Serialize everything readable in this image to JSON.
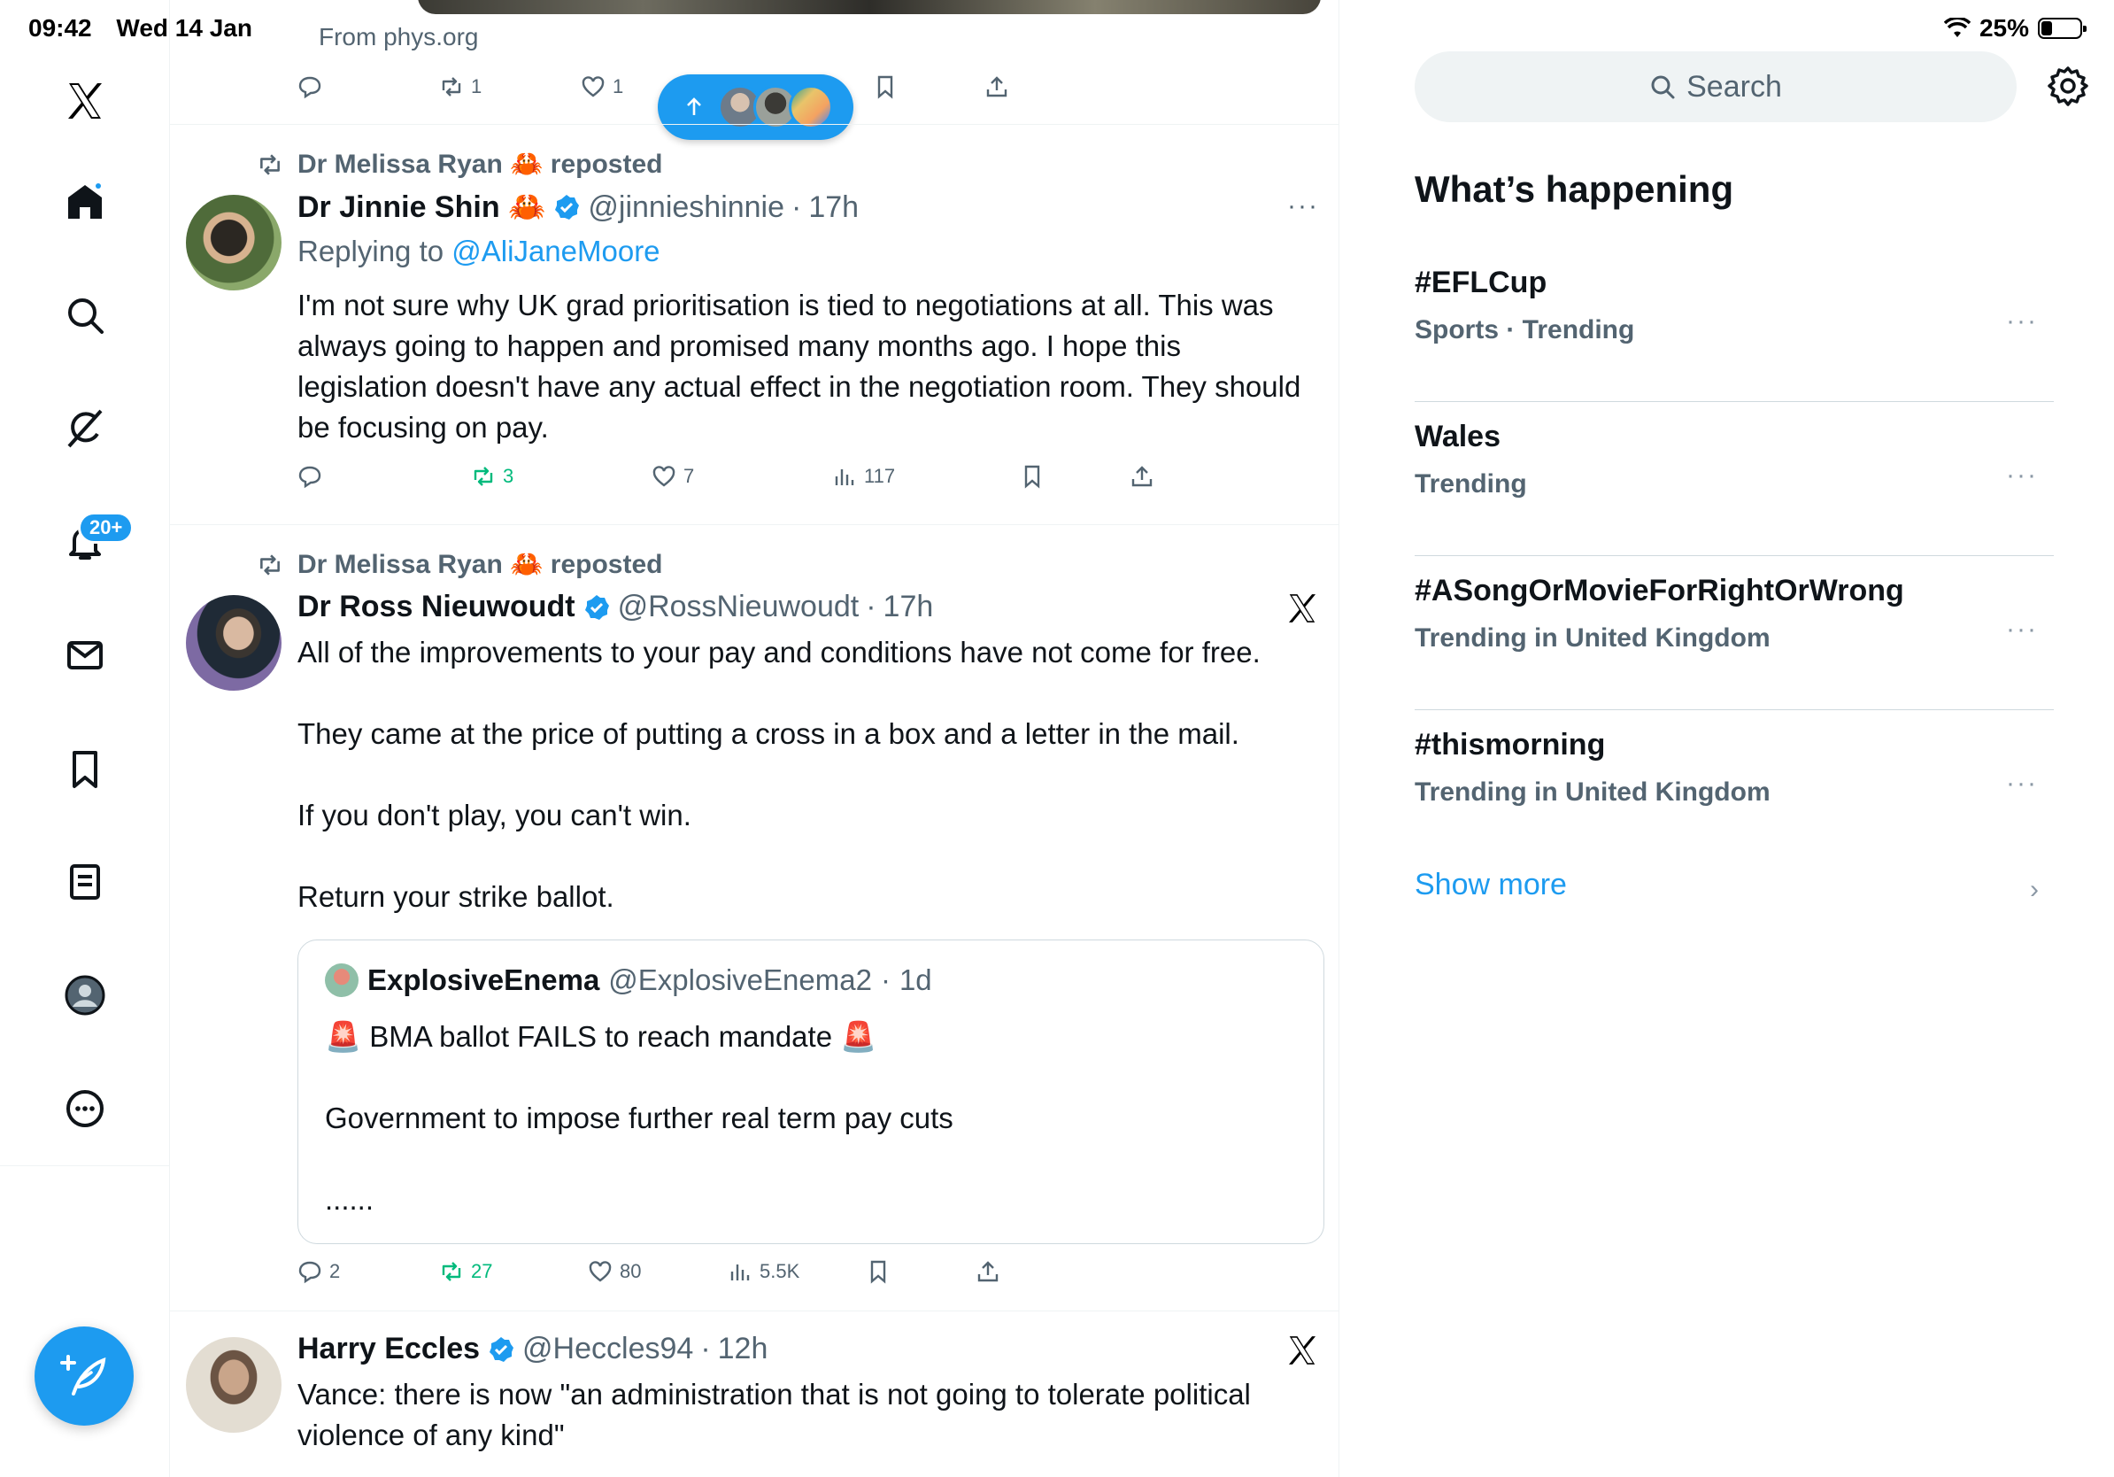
{
  "status_bar": {
    "time": "09:42",
    "date": "Wed 14 Jan",
    "battery": "25%"
  },
  "sidebar": {
    "items": [
      {
        "name": "x-logo"
      },
      {
        "name": "home"
      },
      {
        "name": "explore"
      },
      {
        "name": "grok"
      },
      {
        "name": "notifications"
      },
      {
        "name": "messages"
      },
      {
        "name": "bookmarks"
      },
      {
        "name": "lists"
      },
      {
        "name": "profile"
      },
      {
        "name": "more"
      }
    ],
    "notification_badge": "20+"
  },
  "feed": {
    "previous_post": {
      "source": "From phys.org",
      "replies": "",
      "reposts": "1",
      "likes": "1"
    },
    "posts": [
      {
        "repost_by": "Dr Melissa Ryan 🦀 reposted",
        "author": "Dr Jinnie Shin 🦀",
        "handle": "@jinnieshinnie",
        "time": "17h",
        "replying_prefix": "Replying to ",
        "replying_to": "@AliJaneMoore",
        "text": "I'm not sure why UK grad prioritisation is tied to negotiations at all. This was always going to happen and promised many months ago. I hope this legislation doesn't have any actual effect in the negotiation room. They should be focusing on pay.",
        "replies": "",
        "reposts": "3",
        "likes": "7",
        "views": "117",
        "more": "···"
      },
      {
        "repost_by": "Dr Melissa Ryan 🦀 reposted",
        "author": "Dr Ross Nieuwoudt",
        "handle": "@RossNieuwoudt",
        "time": "17h",
        "text": "All of the improvements to your pay and conditions have not come for free.\n\nThey came at the price of putting a cross in a box and a letter in the mail.\n\nIf you don't play, you can't win.\n\nReturn your strike ballot.",
        "quote": {
          "author": "ExplosiveEnema",
          "handle": "@ExplosiveEnema2",
          "time": "1d",
          "text": "🚨 BMA ballot FAILS to reach mandate 🚨\n\nGovernment to impose further real term pay cuts\n\n......"
        },
        "replies": "2",
        "reposts": "27",
        "likes": "80",
        "views": "5.5K"
      },
      {
        "author": "Harry Eccles",
        "handle": "@Heccles94",
        "time": "12h",
        "text": "Vance: there is now \"an administration that is not going to tolerate political violence of any kind\""
      }
    ],
    "separator": "·"
  },
  "right_panel": {
    "search_placeholder": "Search",
    "section_title": "What’s happening",
    "trends": [
      {
        "name": "#EFLCup",
        "meta": "Sports · Trending"
      },
      {
        "name": "Wales",
        "meta": "Trending"
      },
      {
        "name": "#ASongOrMovieForRightOrWrong",
        "meta": "Trending in United Kingdom"
      },
      {
        "name": "#thismorning",
        "meta": "Trending in United Kingdom"
      }
    ],
    "trend_more": "···",
    "show_more": "Show more",
    "show_more_chevron": "›"
  },
  "colors": {
    "accent": "#1d9bf0",
    "repost_green": "#00ba7c",
    "secondary_text": "#536471"
  }
}
